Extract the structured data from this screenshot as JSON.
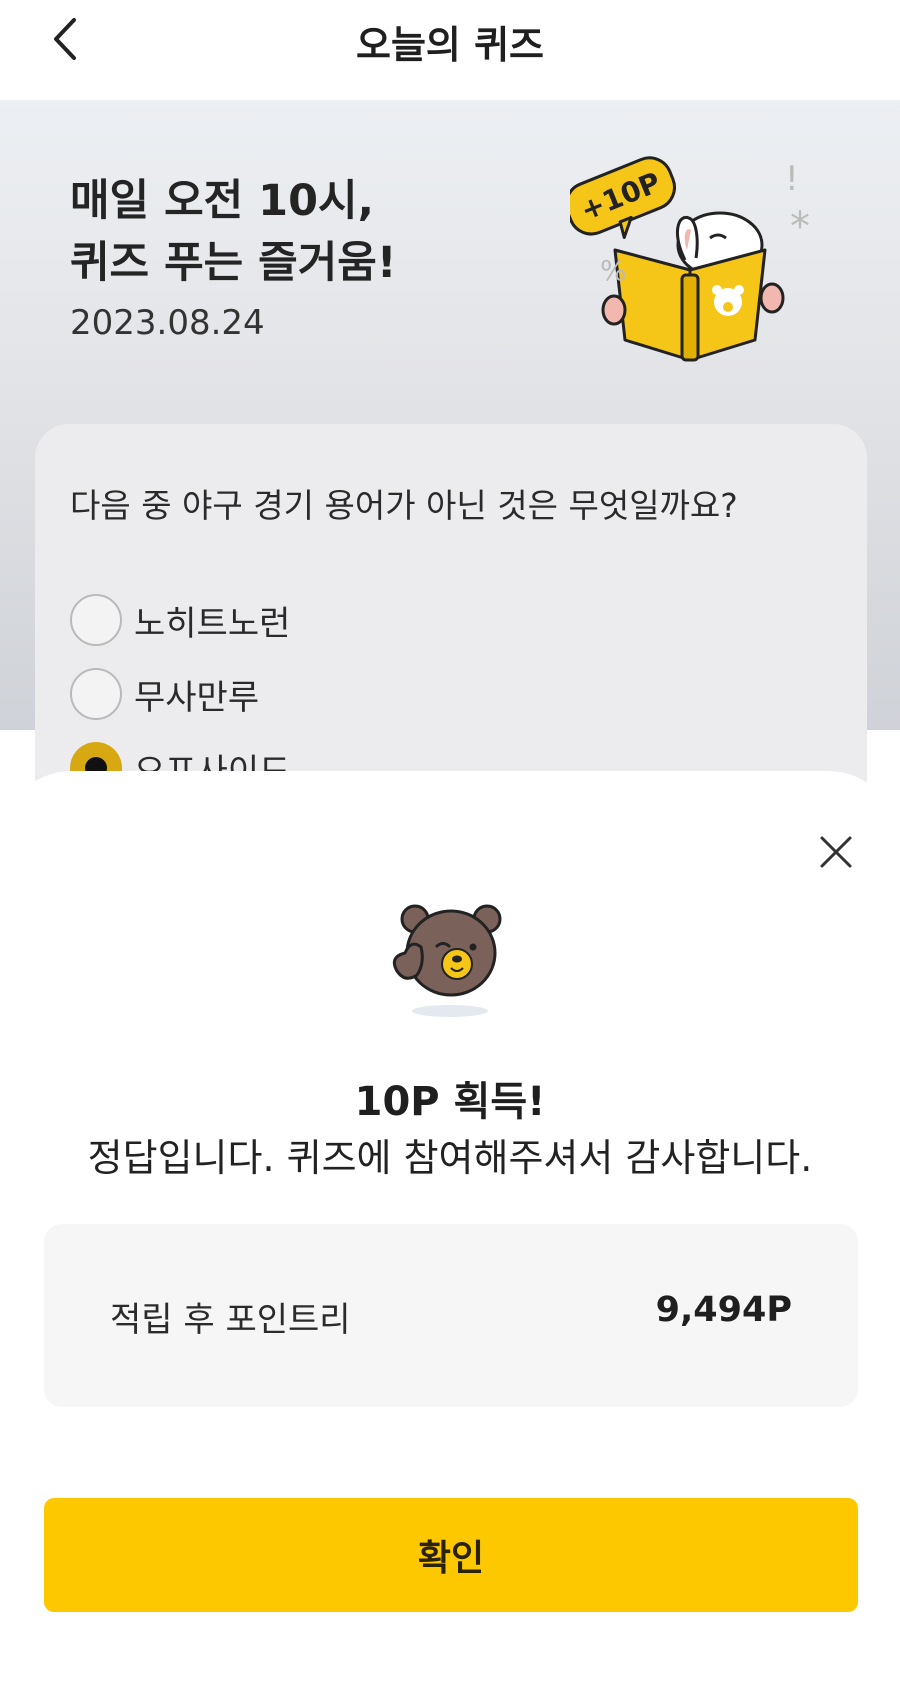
{
  "header": {
    "title": "오늘의 퀴즈",
    "back_icon": "chevron-left-icon"
  },
  "hero": {
    "title": "매일 오전 10시,\n퀴즈 푸는 즐거움!",
    "date": "2023.08.24",
    "badge_text": "+10P"
  },
  "quiz": {
    "question": "다음 중 야구 경기 용어가 아닌 것은 무엇일까요?",
    "options": [
      {
        "label": "노히트노런",
        "selected": false
      },
      {
        "label": "무사만루",
        "selected": false
      },
      {
        "label": "오프사이드",
        "selected": true
      }
    ]
  },
  "result_sheet": {
    "reward_title": "10P 획득!",
    "message": "정답입니다. 퀴즈에 참여해주셔서 감사합니다.",
    "points_label": "적립 후 포인트리",
    "points_value": "9,494P",
    "confirm_label": "확인",
    "close_icon": "close-icon"
  },
  "colors": {
    "accent": "#FDC800",
    "selected_radio": "#D8A812"
  }
}
